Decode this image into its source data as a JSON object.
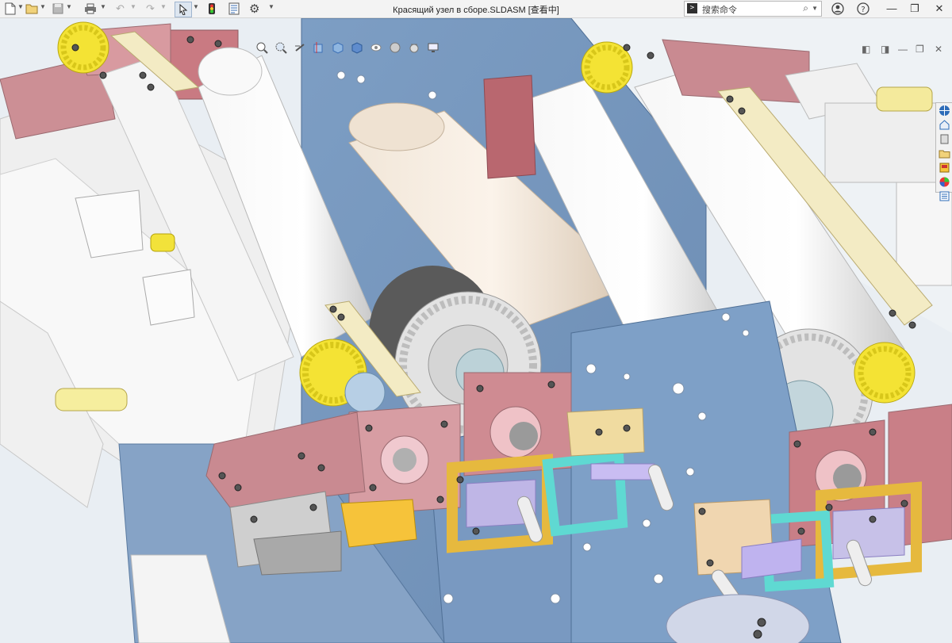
{
  "window": {
    "title": "Красящий узел в сборе.SLDASM [查看中]"
  },
  "search": {
    "placeholder": "搜索命令"
  },
  "toolbar": {
    "items": [
      "new-icon",
      "open-icon",
      "save-icon",
      "print-icon",
      "undo-icon",
      "redo-icon",
      "select-icon",
      "rebuild-icon",
      "file-properties-icon",
      "options-icon"
    ]
  },
  "window_controls": [
    "help-icon",
    "user-icon",
    "minimize-icon",
    "restore-icon",
    "close-icon"
  ],
  "heads_up_toolbar": [
    "zoom-to-fit-icon",
    "zoom-to-area-icon",
    "previous-view-icon",
    "section-view-icon",
    "view-orientation-icon",
    "display-style-icon",
    "hide-show-icon",
    "edit-appearance-icon",
    "apply-scene-icon",
    "view-settings-icon"
  ],
  "task_pane": [
    "solidworks-resources-icon",
    "design-library-icon",
    "file-explorer-icon",
    "view-palette-icon",
    "appearances-icon",
    "custom-properties-icon"
  ],
  "colors": {
    "titlebar": "#f3f3f3",
    "background": "#e9eef3",
    "frame_blue": "#7d9bbf",
    "roller_white": "#f3f3f3",
    "bracket_red": "#c98e95",
    "gear_yellow": "#f2e23a",
    "bracket_cyan": "#5fd9d2",
    "bracket_tan": "#f0dba0"
  }
}
